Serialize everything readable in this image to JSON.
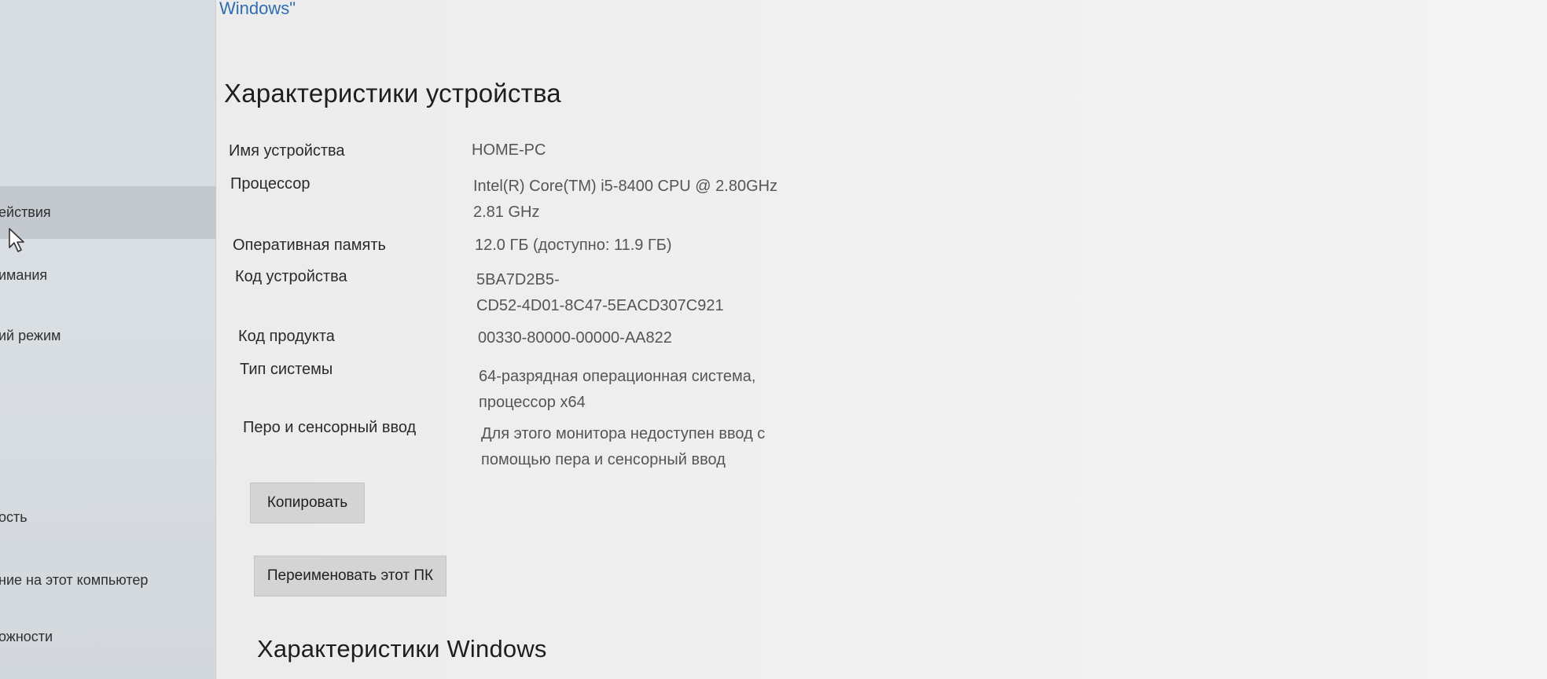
{
  "sidebar": {
    "items": [
      {
        "label": "ействия"
      },
      {
        "label": "имания"
      },
      {
        "label": "ий режим"
      },
      {
        "label": "ость"
      },
      {
        "label": "ние на этот компьютер"
      },
      {
        "label": "ожности"
      }
    ]
  },
  "header": {
    "link": "Windows\""
  },
  "device_specs": {
    "title": "Характеристики устройства",
    "rows": [
      {
        "label": "Имя устройства",
        "value_lines": [
          "HOME-PC"
        ]
      },
      {
        "label": "Процессор",
        "value_lines": [
          "Intel(R) Core(TM) i5-8400 CPU @ 2.80GHz",
          "2.81 GHz"
        ]
      },
      {
        "label": "Оперативная память",
        "value_lines": [
          "12.0 ГБ (доступно: 11.9 ГБ)"
        ]
      },
      {
        "label": "Код устройства",
        "value_lines": [
          "5BA7D2B5-",
          "CD52-4D01-8C47-5EACD307C921"
        ]
      },
      {
        "label": "Код продукта",
        "value_lines": [
          "00330-80000-00000-AA822"
        ]
      },
      {
        "label": "Тип системы",
        "value_lines": [
          "64-разрядная операционная система,",
          "процессор x64"
        ]
      },
      {
        "label": "Перо и сенсорный ввод",
        "value_lines": [
          "Для этого монитора недоступен ввод с",
          "помощью пера и сенсорный ввод"
        ]
      }
    ]
  },
  "buttons": {
    "copy": "Копировать",
    "rename": "Переименовать этот ПК"
  },
  "windows_specs": {
    "title": "Характеристики Windows"
  },
  "colors": {
    "link": "#2f6cb0",
    "sidebar_bg": "#d6dce1",
    "sidebar_selected": "#c3c9cf",
    "button_bg": "#d4d4d4"
  }
}
